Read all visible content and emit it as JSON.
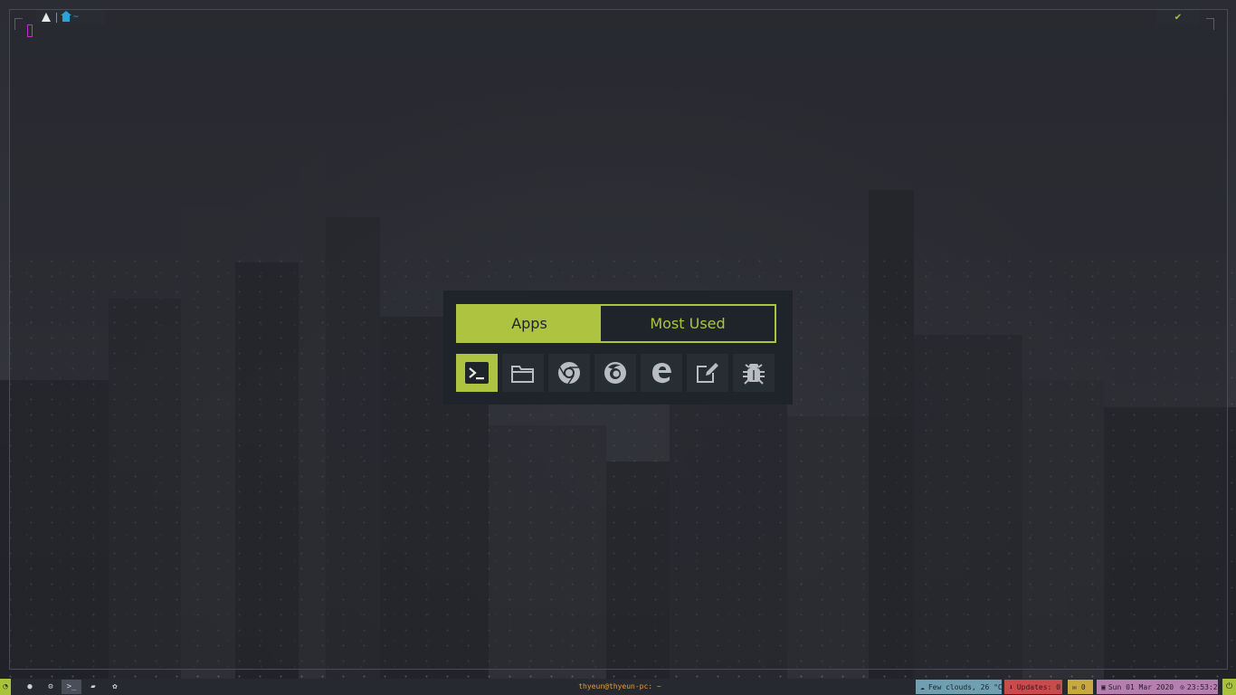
{
  "topbar": {
    "os_icon": "arch-linux-icon",
    "home_icon": "home-icon",
    "path": "~",
    "status_icon": "check-icon",
    "accent": "#aec441"
  },
  "launcher": {
    "modes": [
      {
        "label": "Apps",
        "active": true
      },
      {
        "label": "Most Used",
        "active": false
      }
    ],
    "apps": [
      {
        "icon": "terminal-icon",
        "selected": true
      },
      {
        "icon": "folder-icon",
        "selected": false
      },
      {
        "icon": "chrome-icon",
        "selected": false
      },
      {
        "icon": "firefox-icon",
        "selected": false
      },
      {
        "icon": "edge-icon",
        "selected": false
      },
      {
        "icon": "text-editor-icon",
        "selected": false
      },
      {
        "icon": "bug-icon",
        "selected": false
      }
    ]
  },
  "panel": {
    "buttons": [
      "menu-icon",
      "browser-icon",
      "settings-icon",
      "terminal-icon",
      "folder-icon",
      "paw-icon"
    ],
    "window_title": "thyeun@thyeun-pc: ~",
    "weather": "Few clouds, 26 °C",
    "updates": "Updates: 0",
    "mail": "0",
    "date": "Sun 01 Mar 2020",
    "time": "23:53:27",
    "colors": {
      "weather": "#6f9fb0",
      "updates": "#c94b4b",
      "mail": "#c7a93f",
      "date": "#b77fb0",
      "title": "#e39b3a"
    }
  }
}
